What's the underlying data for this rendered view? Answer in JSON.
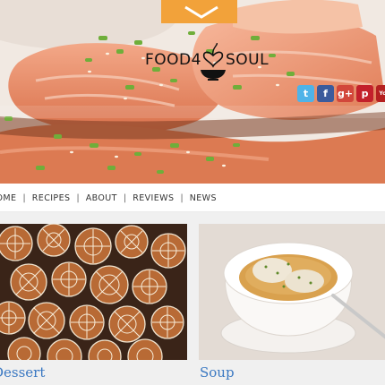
{
  "site": {
    "logo_left": "FOOD4",
    "logo_right": "SOUL"
  },
  "social": [
    {
      "name": "twitter",
      "glyph": "t",
      "color": "#4fb3e8"
    },
    {
      "name": "facebook",
      "glyph": "f",
      "color": "#3b5b9c"
    },
    {
      "name": "google-plus",
      "glyph": "g+",
      "color": "#d2473b"
    },
    {
      "name": "pinterest",
      "glyph": "p",
      "color": "#c3202b"
    },
    {
      "name": "youtube",
      "glyph": "You",
      "color": "#b52020"
    }
  ],
  "nav": {
    "home": "HOME",
    "recipes": "RECIPES",
    "about": "ABOUT",
    "reviews": "REVIEWS",
    "news": "NEWS",
    "separator": "|"
  },
  "cards": {
    "left": {
      "title": "Dessert",
      "image": "gingerbread-cookies-image"
    },
    "right": {
      "title": "Soup",
      "image": "dumpling-soup-image"
    }
  },
  "colors": {
    "banner": "#f2a23a",
    "link": "#3a78c2",
    "content_bg": "#f0f0f0"
  }
}
